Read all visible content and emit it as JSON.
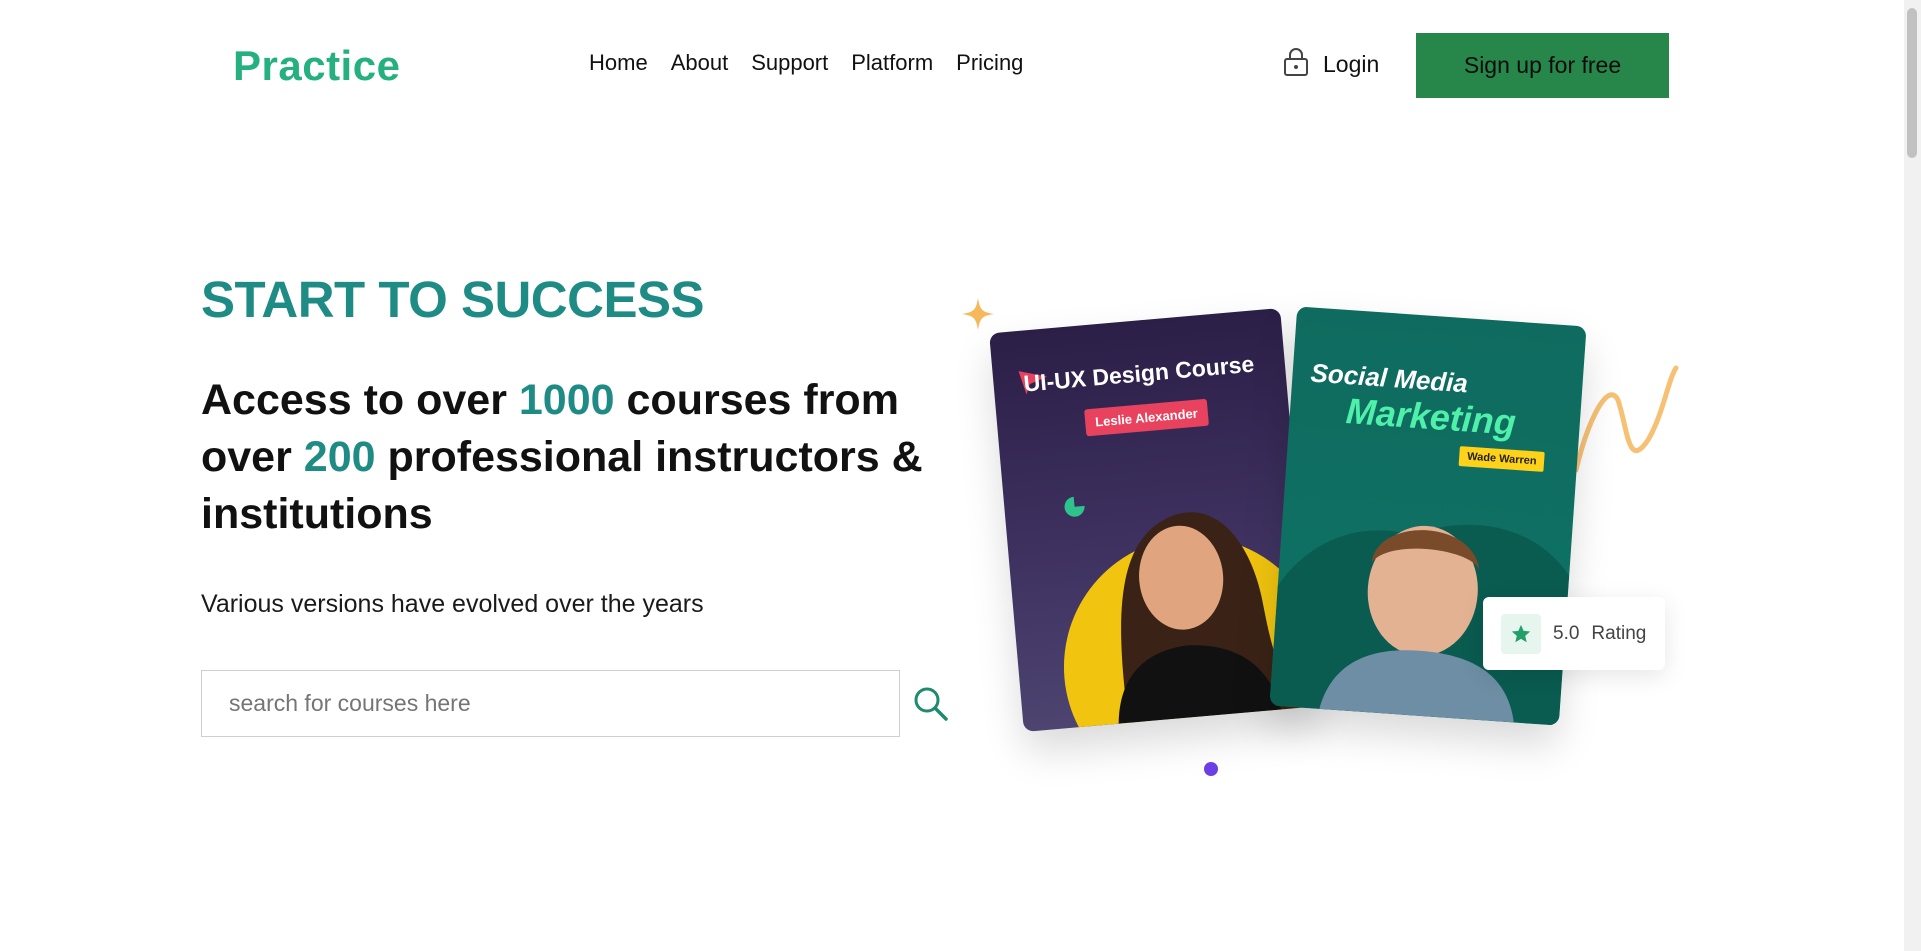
{
  "header": {
    "logo": "Practice",
    "nav": [
      "Home",
      "About",
      "Support",
      "Platform",
      "Pricing"
    ],
    "login_label": "Login",
    "signup_label": "Sign up for free"
  },
  "hero": {
    "eyebrow": "START TO SUCCESS",
    "headline": {
      "part1": "Access to over ",
      "num1": "1000",
      "part2": " courses from over ",
      "num2": "200",
      "part3": " professional instructors & institutions"
    },
    "subtext": "Various versions have evolved over the years",
    "search_placeholder": "search for courses here"
  },
  "cards": [
    {
      "title": "UI-UX Design Course",
      "instructor": "Leslie Alexander"
    },
    {
      "title_line1": "Social Media",
      "title_line2": "Marketing",
      "instructor": "Wade Warren"
    }
  ],
  "rating": {
    "value": "5.0",
    "label": "Rating"
  },
  "colors": {
    "brand": "#25b07f",
    "teal": "#1f8b85",
    "signup_bg": "#27874a",
    "dot": "#6a3fe6"
  },
  "icons": [
    "lock-icon",
    "search-icon",
    "star-icon",
    "sparkle-icon",
    "squiggle-icon"
  ]
}
